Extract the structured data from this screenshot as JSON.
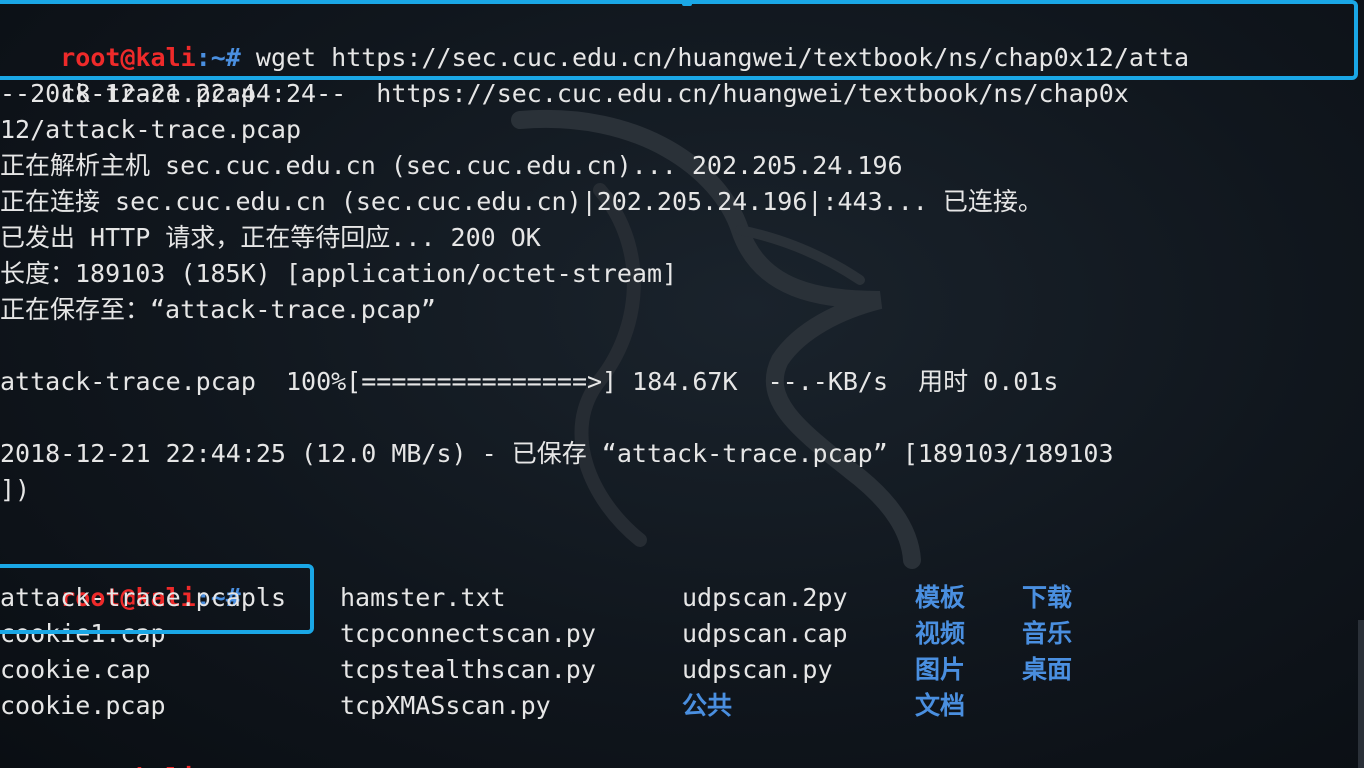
{
  "prompt": {
    "user": "root@kali",
    "path": ":~#"
  },
  "lines": [
    {
      "id": "cmd1a",
      "text": " wget https://sec.cuc.edu.cn/huangwei/textbook/ns/chap0x12/atta"
    },
    {
      "id": "cmd1b",
      "text": "ck-trace.pcap"
    },
    {
      "id": "out1",
      "text": "--2018-12-21 22:44:24--  https://sec.cuc.edu.cn/huangwei/textbook/ns/chap0x"
    },
    {
      "id": "out2",
      "text": "12/attack-trace.pcap"
    },
    {
      "id": "out3",
      "text": "正在解析主机 sec.cuc.edu.cn (sec.cuc.edu.cn)... 202.205.24.196"
    },
    {
      "id": "out4",
      "text": "正在连接 sec.cuc.edu.cn (sec.cuc.edu.cn)|202.205.24.196|:443... 已连接。"
    },
    {
      "id": "out5",
      "text": "已发出 HTTP 请求，正在等待回应... 200 OK"
    },
    {
      "id": "out6",
      "text": "长度：189103 (185K) [application/octet-stream]"
    },
    {
      "id": "out7",
      "text": "正在保存至：“attack-trace.pcap”"
    },
    {
      "id": "out8",
      "text": "attack-trace.pcap  100%[===============>] 184.67K  --.-KB/s  用时 0.01s"
    },
    {
      "id": "out9",
      "text": "2018-12-21 22:44:25 (12.0 MB/s) - 已保存 “attack-trace.pcap” [189103/189103"
    },
    {
      "id": "out10",
      "text": "])"
    }
  ],
  "ls_command": " ls",
  "ls_listing": {
    "col1": [
      "attack-trace.pcap",
      "cookie1.cap",
      "cookie.cap",
      "cookie.pcap"
    ],
    "col2": [
      "hamster.txt",
      "tcpconnectscan.py",
      "tcpstealthscan.py",
      "tcpXMASscan.py"
    ],
    "col3": [
      "udpscan.2py",
      "udpscan.cap",
      "udpscan.py",
      "公共"
    ],
    "col4": [
      "模板",
      "视频",
      "图片",
      "文档"
    ],
    "col5": [
      "下载",
      "音乐",
      "桌面",
      ""
    ]
  },
  "directories": [
    "公共",
    "模板",
    "视频",
    "图片",
    "文档",
    "下载",
    "音乐",
    "桌面"
  ],
  "colors": {
    "prompt_user": "#ee2a2a",
    "prompt_path": "#4a8fe0",
    "highlight": "#1aa7e6",
    "text": "#e6e6e6"
  }
}
